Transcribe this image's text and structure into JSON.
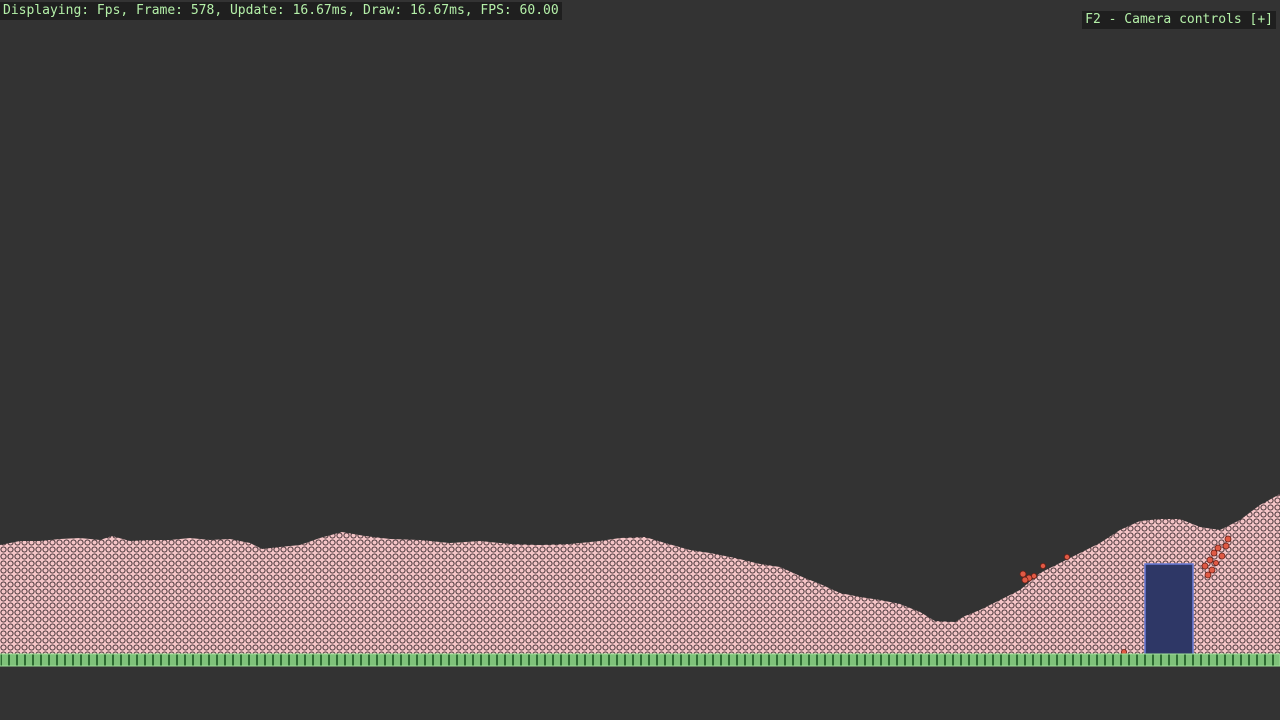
{
  "hud": {
    "stats": "Displaying: Fps, Frame: 578, Update: 16.67ms, Draw: 16.67ms, FPS: 60.00",
    "camera_controls": "F2 - Camera controls [+]"
  },
  "colors": {
    "background": "#333333",
    "particle_fill": "#f4c4c6",
    "particle_outline": "#3a2a2e",
    "highlight_particle": "#e05a45",
    "ground_fill": "#7fc27a",
    "ground_stripe": "#2e6b33",
    "body_fill": "#2e3766",
    "body_outline": "#6a7cd8",
    "hud_text": "#b4f0a8"
  }
}
